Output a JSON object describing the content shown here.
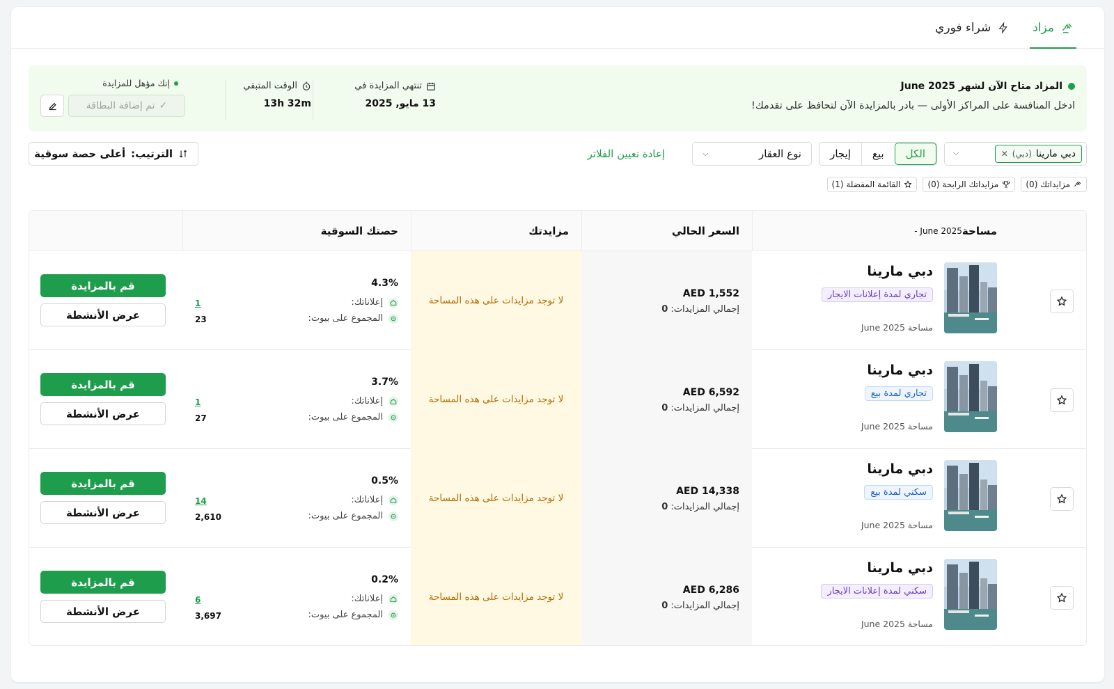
{
  "tabs": [
    {
      "label": "مزاد",
      "icon": "gavel-icon",
      "active": true
    },
    {
      "label": "شراء فوري",
      "icon": "lightning-icon",
      "active": false
    }
  ],
  "banner": {
    "title": "المزاد متاح الآن لشهر June 2025",
    "subtitle": "ادخل المنافسة على المراكز الأولى — بادر بالمزايدة الآن لتحافظ على تقدمك!",
    "ends_label": "تنتهي المزايدة في",
    "ends_value": "13 مايو, 2025",
    "remaining_label": "الوقت المتبقي",
    "remaining_value": "13h 32m",
    "eligible_label": "إنك مؤهل للمزايدة",
    "card_added": "تم إضافة البطاقة"
  },
  "filters": {
    "location_chip": "دبي مارينا",
    "location_sub": "(دبي)",
    "segments": [
      "الكل",
      "بيع",
      "إيجار"
    ],
    "active_segment": "الكل",
    "property_type": "نوع العقار",
    "reset": "إعادة تعيين الفلاتر",
    "sort_label": "الترتيب:",
    "sort_value": "أعلى حصة سوقية"
  },
  "pills": [
    {
      "label": "مزايداتك (0)",
      "icon": "gavel-icon"
    },
    {
      "label": "مزايداتك الرابحة (0)",
      "icon": "trophy-icon"
    },
    {
      "label": "القائمة المفضلة (1)",
      "icon": "star-icon"
    }
  ],
  "table": {
    "headers": {
      "area": "مساحة",
      "area_month": "June 2025 -",
      "price": "السعر الحالي",
      "your_bid": "مزايدتك",
      "share": "حصتك السوقية"
    },
    "rows": [
      {
        "name": "دبي مارينا",
        "tag": "تجاري لمدة إعلانات الايجار",
        "tag_color": "purple",
        "date": "مساحة June 2025",
        "price": "1,552 AED",
        "bids": "إجمالي المزايدات:",
        "bids_count": "0",
        "bid_status": "لا توجد مزايدات على هذه المساحة",
        "share_pct": "4.3%",
        "listings_label": "إعلاناتك:",
        "listings": "1",
        "total_label": "المجموع على بيوت:",
        "total": "23",
        "bid_btn": "قم بالمزايدة",
        "activity_btn": "عرض الأنشطة"
      },
      {
        "name": "دبي مارينا",
        "tag": "تجاري لمدة بيع",
        "tag_color": "blue",
        "date": "مساحة June 2025",
        "price": "6,592 AED",
        "bids": "إجمالي المزايدات:",
        "bids_count": "0",
        "bid_status": "لا توجد مزايدات على هذه المساحة",
        "share_pct": "3.7%",
        "listings_label": "إعلاناتك:",
        "listings": "1",
        "total_label": "المجموع على بيوت:",
        "total": "27",
        "bid_btn": "قم بالمزايدة",
        "activity_btn": "عرض الأنشطة"
      },
      {
        "name": "دبي مارينا",
        "tag": "سكني لمدة بيع",
        "tag_color": "blue",
        "date": "مساحة June 2025",
        "price": "14,338 AED",
        "bids": "إجمالي المزايدات:",
        "bids_count": "0",
        "bid_status": "لا توجد مزايدات على هذه المساحة",
        "share_pct": "0.5%",
        "listings_label": "إعلاناتك:",
        "listings": "14",
        "total_label": "المجموع على بيوت:",
        "total": "2,610",
        "bid_btn": "قم بالمزايدة",
        "activity_btn": "عرض الأنشطة"
      },
      {
        "name": "دبي مارينا",
        "tag": "سكني لمدة إعلانات الايجار",
        "tag_color": "purple",
        "date": "مساحة June 2025",
        "price": "6,286 AED",
        "bids": "إجمالي المزايدات:",
        "bids_count": "0",
        "bid_status": "لا توجد مزايدات على هذه المساحة",
        "share_pct": "0.2%",
        "listings_label": "إعلاناتك:",
        "listings": "6",
        "total_label": "المجموع على بيوت:",
        "total": "3,697",
        "bid_btn": "قم بالمزايدة",
        "activity_btn": "عرض الأنشطة"
      }
    ]
  },
  "colors": {
    "accent": "#1e9e4d",
    "banner_bg": "#f1fbee",
    "bid_cell_bg": "#fff9e3",
    "bid_text": "#b36b00"
  }
}
